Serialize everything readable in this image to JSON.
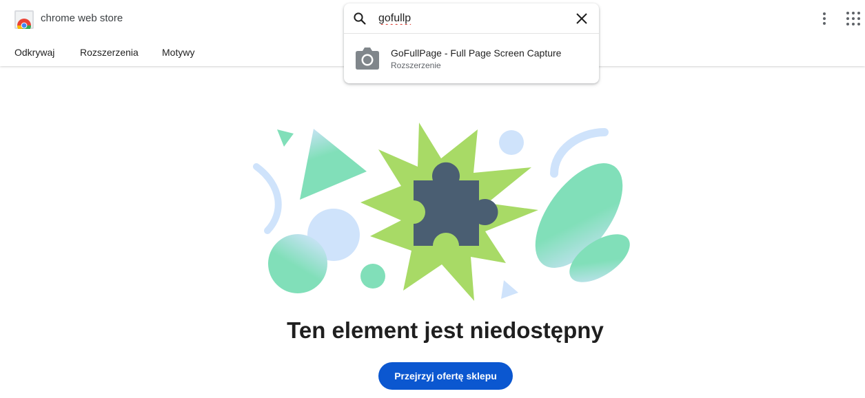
{
  "header": {
    "brand": "chrome web store",
    "nav": [
      "Odkrywaj",
      "Rozszerzenia",
      "Motywy"
    ],
    "icons": {
      "logo": "chrome-web-store-logo",
      "menu": "more-vert-icon",
      "apps": "apps-grid-icon"
    }
  },
  "search": {
    "value": "gofullp",
    "icon": "search-icon",
    "clear_icon": "close-icon",
    "suggestions": [
      {
        "title": "GoFullPage - Full Page Screen Capture",
        "subtitle": "Rozszerzenie",
        "icon": "camera-icon"
      }
    ]
  },
  "main": {
    "heading": "Ten element jest niedostępny",
    "button": "Przejrzyj ofertę sklepu",
    "illustration": "puzzle-piece-illustration"
  },
  "colors": {
    "accent": "#0b57d0",
    "puzzle": "#4a5e72",
    "burst": "#a8da66",
    "mint": "#81dfb9",
    "light_blue": "#cfe3fb"
  }
}
